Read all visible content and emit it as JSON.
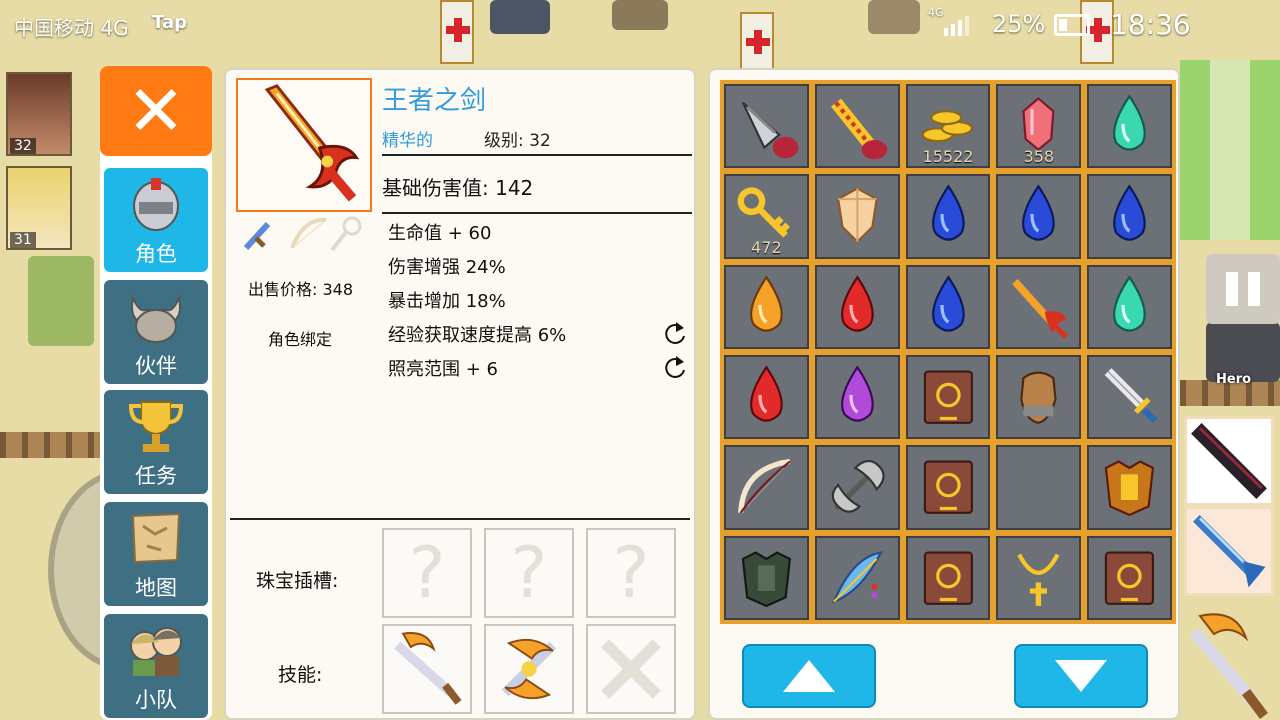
{
  "status_bar": {
    "carrier": "中国移动 4G",
    "tap_label": "Tap",
    "network": "4G",
    "battery": "25%",
    "time": "18:36"
  },
  "party": [
    {
      "level": "32"
    },
    {
      "level": "31"
    }
  ],
  "menu": {
    "close_icon": "close-icon",
    "items": [
      {
        "label": "角色",
        "icon": "helmet-icon",
        "active": true
      },
      {
        "label": "伙伴",
        "icon": "horned-helmet-icon",
        "active": false
      },
      {
        "label": "任务",
        "icon": "trophy-icon",
        "active": false
      },
      {
        "label": "地图",
        "icon": "map-icon",
        "active": false
      },
      {
        "label": "小队",
        "icon": "team-icon",
        "active": false
      }
    ]
  },
  "item": {
    "name": "王者之剑",
    "quality": "精华的",
    "level": "级别: 32",
    "base_damage": "基础伤害值: 142",
    "sell_price": "出售价格: 348",
    "binding": "角色绑定",
    "stats": [
      "生命值 + 60",
      "伤害增强 24%",
      "暴击增加 18%",
      "经验获取速度提高 6%",
      "照亮范围 + 6"
    ],
    "socket_label": "珠宝插槽:",
    "sockets": [
      "?",
      "?",
      "?"
    ],
    "skill_label": "技能:",
    "skills": [
      "slash-skill-icon",
      "whirlwind-skill-icon",
      "locked-skill-icon"
    ]
  },
  "inventory": {
    "cells": [
      {
        "icon": "drill-bomb-icon"
      },
      {
        "icon": "firework-icon"
      },
      {
        "icon": "gold-coins-icon",
        "qty": "15522"
      },
      {
        "icon": "red-crystal-icon",
        "qty": "358"
      },
      {
        "icon": "teal-gem-icon"
      },
      {
        "icon": "gold-key-icon",
        "qty": "472"
      },
      {
        "icon": "amber-crystal-icon"
      },
      {
        "icon": "blue-gem-icon"
      },
      {
        "icon": "blue-gem-icon"
      },
      {
        "icon": "blue-gem-icon"
      },
      {
        "icon": "orange-gem-icon"
      },
      {
        "icon": "red-gem-icon"
      },
      {
        "icon": "blue-gem-icon"
      },
      {
        "icon": "flame-sword-icon"
      },
      {
        "icon": "teal-gem-icon"
      },
      {
        "icon": "red-gem-icon"
      },
      {
        "icon": "purple-gem-icon"
      },
      {
        "icon": "spell-book-icon"
      },
      {
        "icon": "leather-glove-icon"
      },
      {
        "icon": "short-sword-icon"
      },
      {
        "icon": "bow-icon"
      },
      {
        "icon": "battle-axe-icon"
      },
      {
        "icon": "spell-book-icon"
      },
      {
        "icon": "empty-slot"
      },
      {
        "icon": "gold-armor-icon"
      },
      {
        "icon": "dark-armor-icon"
      },
      {
        "icon": "feather-icon"
      },
      {
        "icon": "spell-book-icon"
      },
      {
        "icon": "gold-necklace-icon"
      },
      {
        "icon": "spell-book-icon"
      }
    ],
    "scroll_up_icon": "up-arrow-icon",
    "scroll_down_icon": "down-arrow-icon"
  },
  "hud": {
    "hero_label": "Hero",
    "pause_icon": "pause-icon"
  },
  "colors": {
    "accent_blue": "#1fb6e8",
    "close_orange": "#ff7a12",
    "item_name_blue": "#2f9be0",
    "grid_gold": "#e7a02b"
  }
}
